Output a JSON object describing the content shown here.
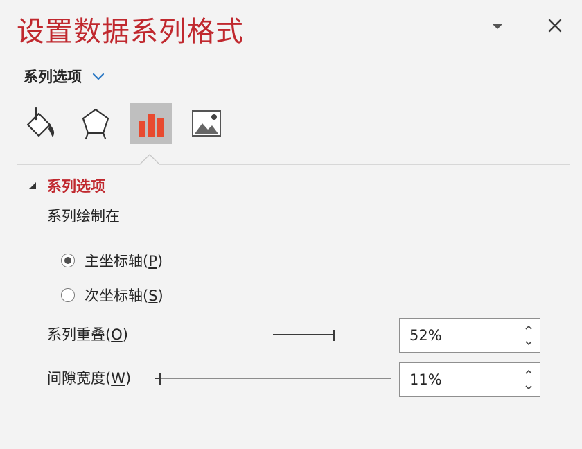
{
  "pane": {
    "title": "设置数据系列格式",
    "menu_icon": "triangle-down-icon",
    "close_icon": "close-icon"
  },
  "category": {
    "label": "系列选项",
    "icon": "chevron-down-icon"
  },
  "tabs": [
    {
      "icon": "fill-line-icon",
      "active": false
    },
    {
      "icon": "effects-pentagon-icon",
      "active": false
    },
    {
      "icon": "series-options-chart-icon",
      "active": true
    },
    {
      "icon": "picture-icon",
      "active": false
    }
  ],
  "section": {
    "title": "系列选项",
    "expanded": true,
    "plot_on_label": "系列绘制在",
    "radios": [
      {
        "label": "主坐标轴(",
        "accel": "P",
        "close": ")",
        "checked": true
      },
      {
        "label": "次坐标轴(",
        "accel": "S",
        "close": ")",
        "checked": false
      }
    ],
    "overlap": {
      "label": "系列重叠(",
      "accel": "O",
      "close": ")",
      "value_text": "52%",
      "value": 52,
      "min": -100,
      "max": 100
    },
    "gap_width": {
      "label": "间隙宽度(",
      "accel": "W",
      "close": ")",
      "value_text": "11%",
      "value": 11,
      "min": 0,
      "max": 500
    }
  },
  "colors": {
    "accent_red": "#c0282e",
    "chevron_blue": "#2b78c4",
    "bar_orange": "#e84a2f",
    "active_tab_bg": "#bfbfbf",
    "pane_bg": "#f3f3f3"
  }
}
